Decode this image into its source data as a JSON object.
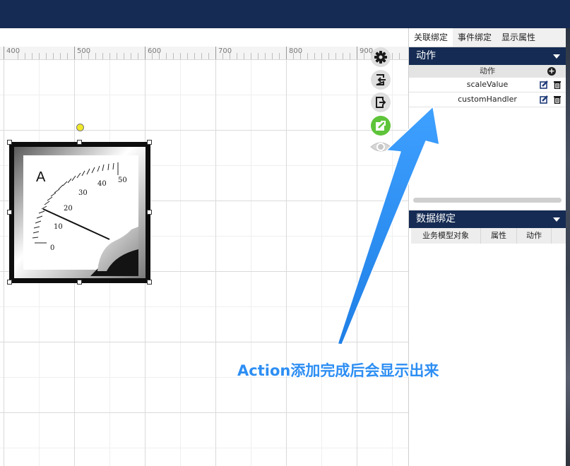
{
  "ruler": {
    "labels": [
      "400",
      "500",
      "600",
      "700",
      "800",
      "900"
    ]
  },
  "meter": {
    "unit": "A",
    "scale": [
      "0",
      "10",
      "20",
      "30",
      "40",
      "50"
    ]
  },
  "toolbar": {
    "icons": [
      "gear-icon",
      "import-icon",
      "export-icon",
      "edit-export-icon",
      "eye-icon"
    ]
  },
  "panel": {
    "tabs": [
      "关联绑定",
      "事件绑定",
      "显示属性"
    ],
    "actions": {
      "title": "动作",
      "column": "动作",
      "items": [
        "scaleValue",
        "customHandler"
      ]
    },
    "data_binding": {
      "title": "数据绑定",
      "columns": [
        "业务模型对象",
        "属性",
        "动作"
      ]
    }
  },
  "annotation": {
    "text": "Action添加完成后会显示出来"
  },
  "colors": {
    "header": "#152b53",
    "accent": "#2d8ef3",
    "toolbar_green": "#5ec43a",
    "handle_yellow": "#f1e82a"
  }
}
